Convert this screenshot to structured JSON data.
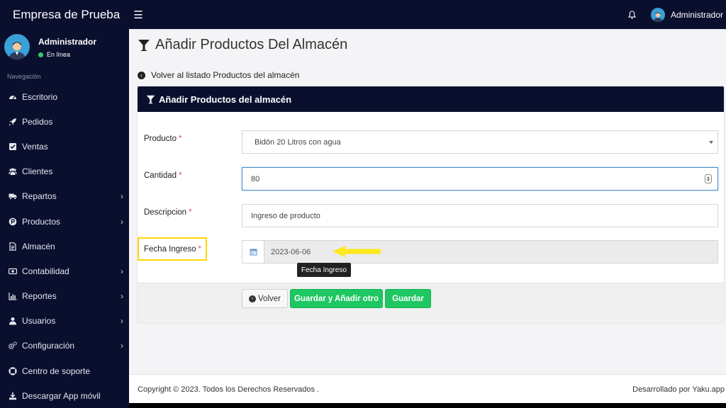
{
  "header": {
    "brand": "Empresa de Prueba",
    "user_name": "Administrador"
  },
  "sidebar": {
    "user_name": "Administrador",
    "status": "En línea",
    "nav_header": "Navegación",
    "items": [
      {
        "label": "Escritorio",
        "icon": "dashboard-icon",
        "has_submenu": false
      },
      {
        "label": "Pedidos",
        "icon": "rocket-icon",
        "has_submenu": false
      },
      {
        "label": "Ventas",
        "icon": "checkbox-icon",
        "has_submenu": false
      },
      {
        "label": "Clientes",
        "icon": "users-icon",
        "has_submenu": false
      },
      {
        "label": "Repartos",
        "icon": "truck-icon",
        "has_submenu": true
      },
      {
        "label": "Productos",
        "icon": "product-p-icon",
        "has_submenu": true
      },
      {
        "label": "Almacén",
        "icon": "document-icon",
        "has_submenu": false
      },
      {
        "label": "Contabilidad",
        "icon": "money-icon",
        "has_submenu": true
      },
      {
        "label": "Reportes",
        "icon": "bar-chart-icon",
        "has_submenu": true
      },
      {
        "label": "Usuarios",
        "icon": "user-icon",
        "has_submenu": true
      },
      {
        "label": "Configuración",
        "icon": "gears-icon",
        "has_submenu": true
      },
      {
        "label": "Centro de soporte",
        "icon": "lifebuoy-icon",
        "has_submenu": false
      },
      {
        "label": "Descargar App móvil",
        "icon": "download-icon",
        "has_submenu": false
      }
    ]
  },
  "page": {
    "title": "Añadir Productos Del Almacén",
    "back_link": "Volver al listado Productos del almacén"
  },
  "card": {
    "title": "Añadir Productos del almacén",
    "fields": {
      "producto": {
        "label": "Producto",
        "value": "Bidón 20 Litros con agua"
      },
      "cantidad": {
        "label": "Cantidad",
        "value": "80"
      },
      "descripcion": {
        "label": "Descripcion",
        "value": "Ingreso de producto"
      },
      "fecha": {
        "label": "Fecha Ingreso",
        "value": "2023-06-06",
        "tooltip": "Fecha Ingreso"
      }
    },
    "buttons": {
      "back": "Volver",
      "save_add": "Guardar y Añadir otro",
      "save": "Guardar"
    }
  },
  "footer": {
    "copyright": "Copyright © 2023. Todos los Derechos Reservados .",
    "developer": "Desarrollado por Yaku.app"
  },
  "colors": {
    "sidebar_bg": "#0b0f2e",
    "primary_green": "#1ec761",
    "highlight_yellow": "#ffd60a",
    "required_red": "#d9534f"
  }
}
